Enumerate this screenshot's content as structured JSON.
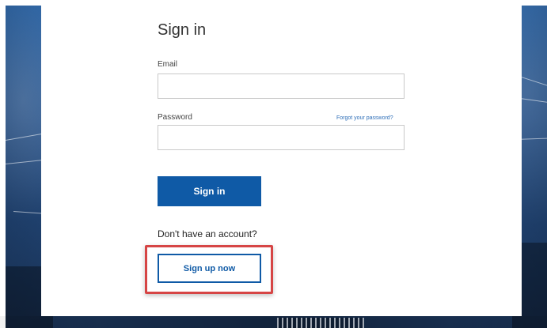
{
  "signin": {
    "title": "Sign in",
    "email_label": "Email",
    "email_value": "",
    "email_placeholder": "",
    "password_label": "Password",
    "password_value": "",
    "password_placeholder": "",
    "forgot_link": "Forgot your password?",
    "signin_button": "Sign in",
    "no_account_text": "Don't have an account?",
    "signup_button": "Sign up now"
  },
  "colors": {
    "primary": "#0f5aa6",
    "highlight": "#d64545",
    "background": "#2d5f9f",
    "card": "#ffffff"
  },
  "icons": []
}
